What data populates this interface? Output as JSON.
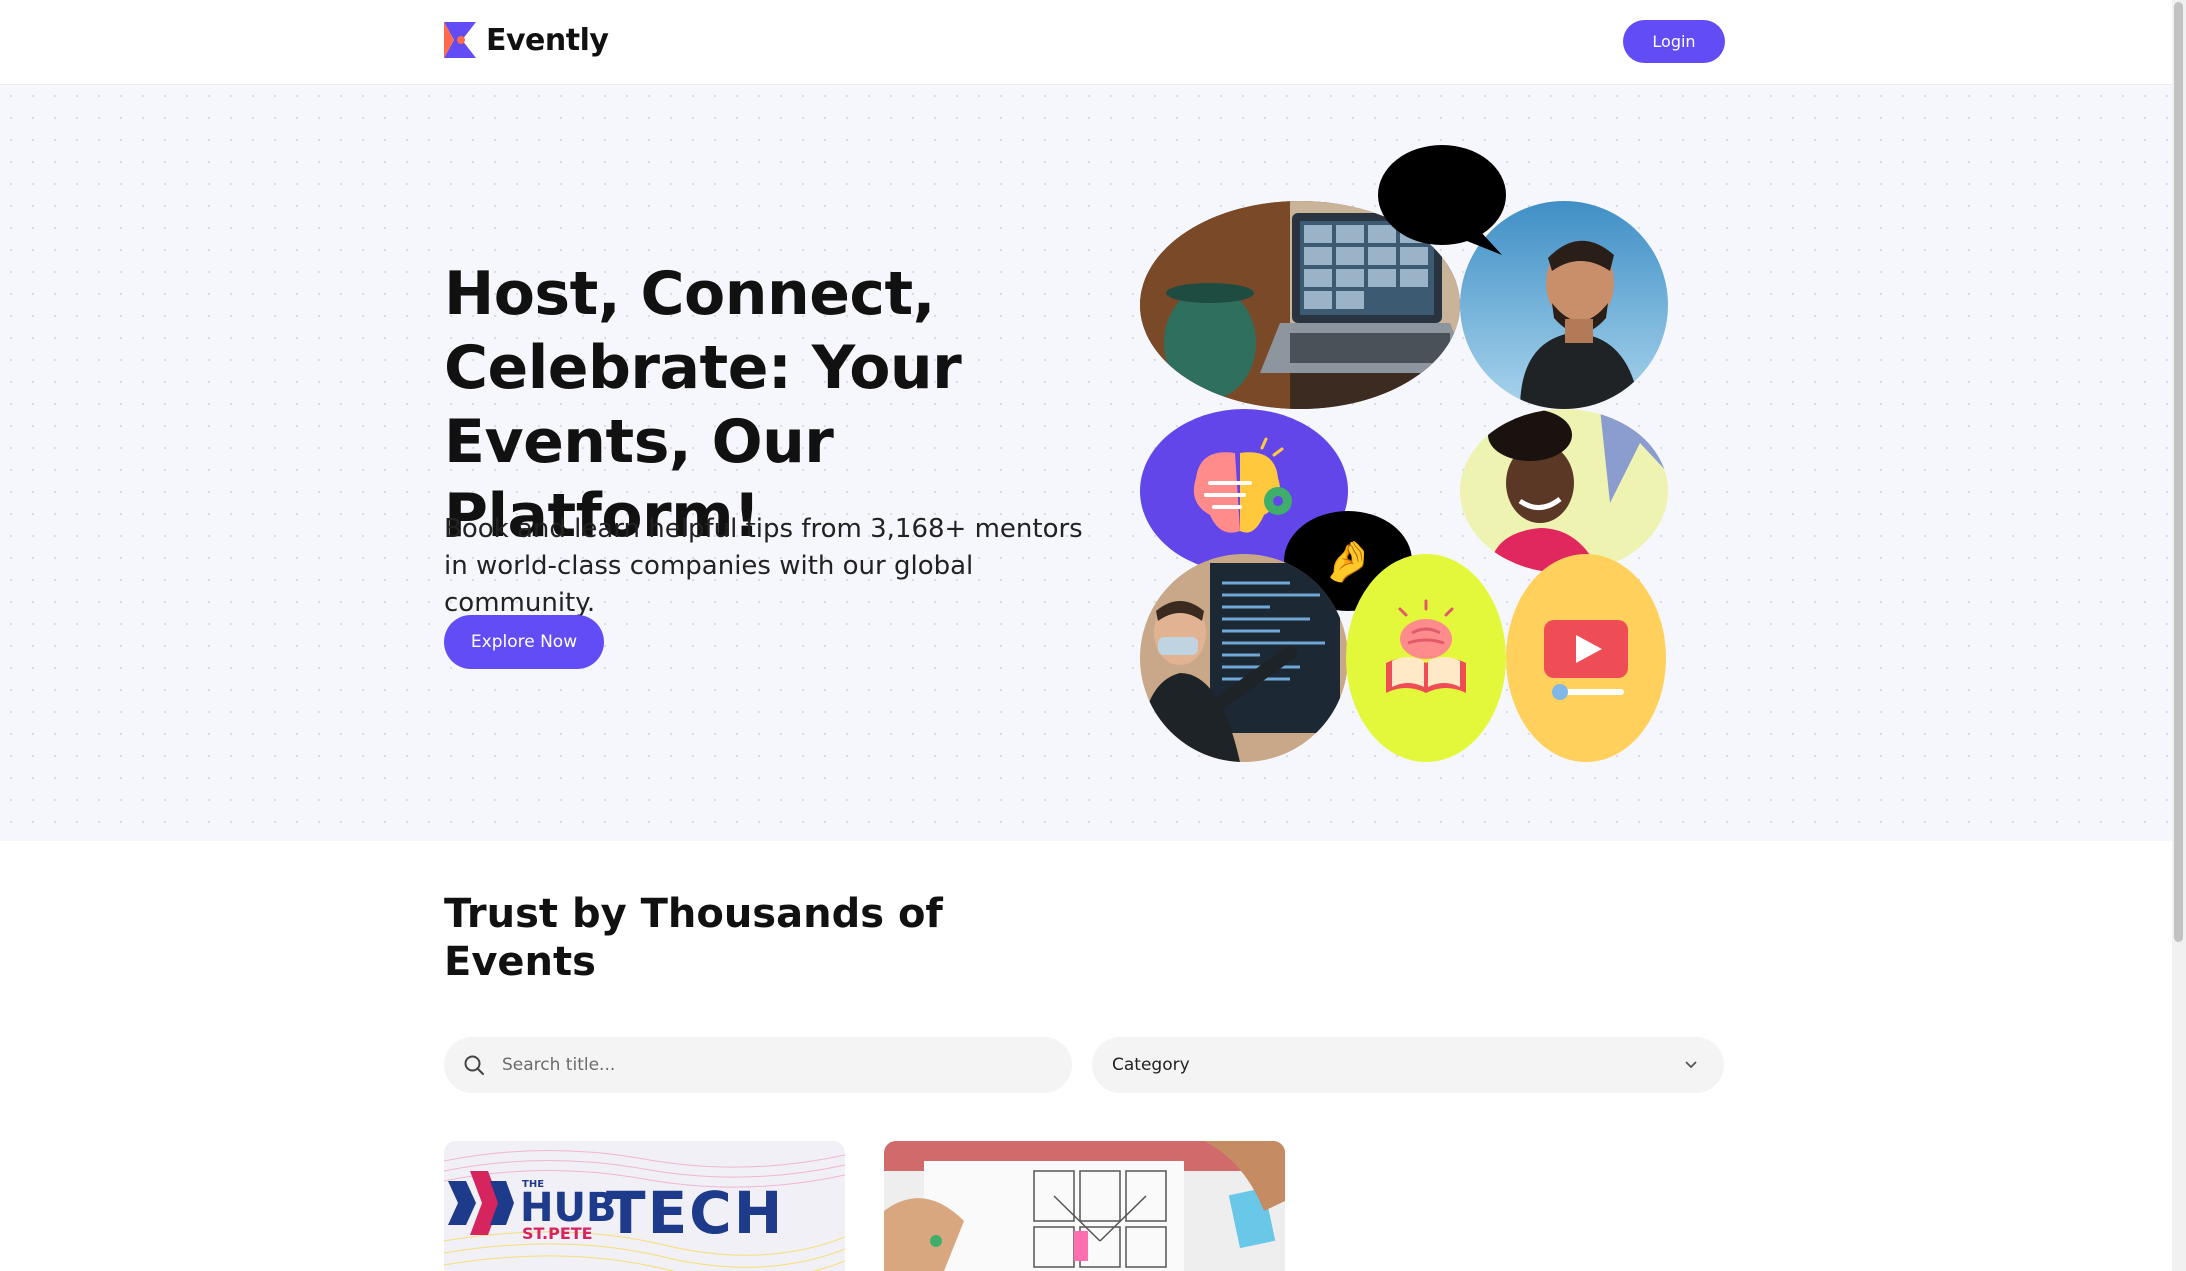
{
  "header": {
    "brand": "Evently",
    "login_label": "Login"
  },
  "hero": {
    "title": "Host, Connect, Celebrate: Your Events, Our Platform!",
    "subtitle": "Book and learn helpful tips from 3,168+ mentors in world-class companies with our global community.",
    "cta_label": "Explore Now"
  },
  "collage": {
    "emojis": [
      "😍",
      "🤌"
    ],
    "icon_names": [
      "brain-gear-icon",
      "brain-book-icon",
      "video-play-icon"
    ]
  },
  "events": {
    "section_title": "Trust by Thousands of Events",
    "search": {
      "placeholder": "Search title..."
    },
    "category": {
      "selected": "Category"
    },
    "cards": [
      {
        "image": "hub-st-pete-tech-banner",
        "logo_top": "THE",
        "logo_main": "HUB",
        "logo_sub": "ST.PETE",
        "word": "TECH"
      },
      {
        "image": "wireframe-sketching-photo"
      }
    ]
  },
  "colors": {
    "accent": "#624cf5",
    "hero_bg": "#f6f7fc",
    "purple_circle": "#6246ea",
    "lime_circle": "#e3f83a",
    "yellow_circle": "#ffd15c",
    "sky": "#5fa8d3"
  }
}
